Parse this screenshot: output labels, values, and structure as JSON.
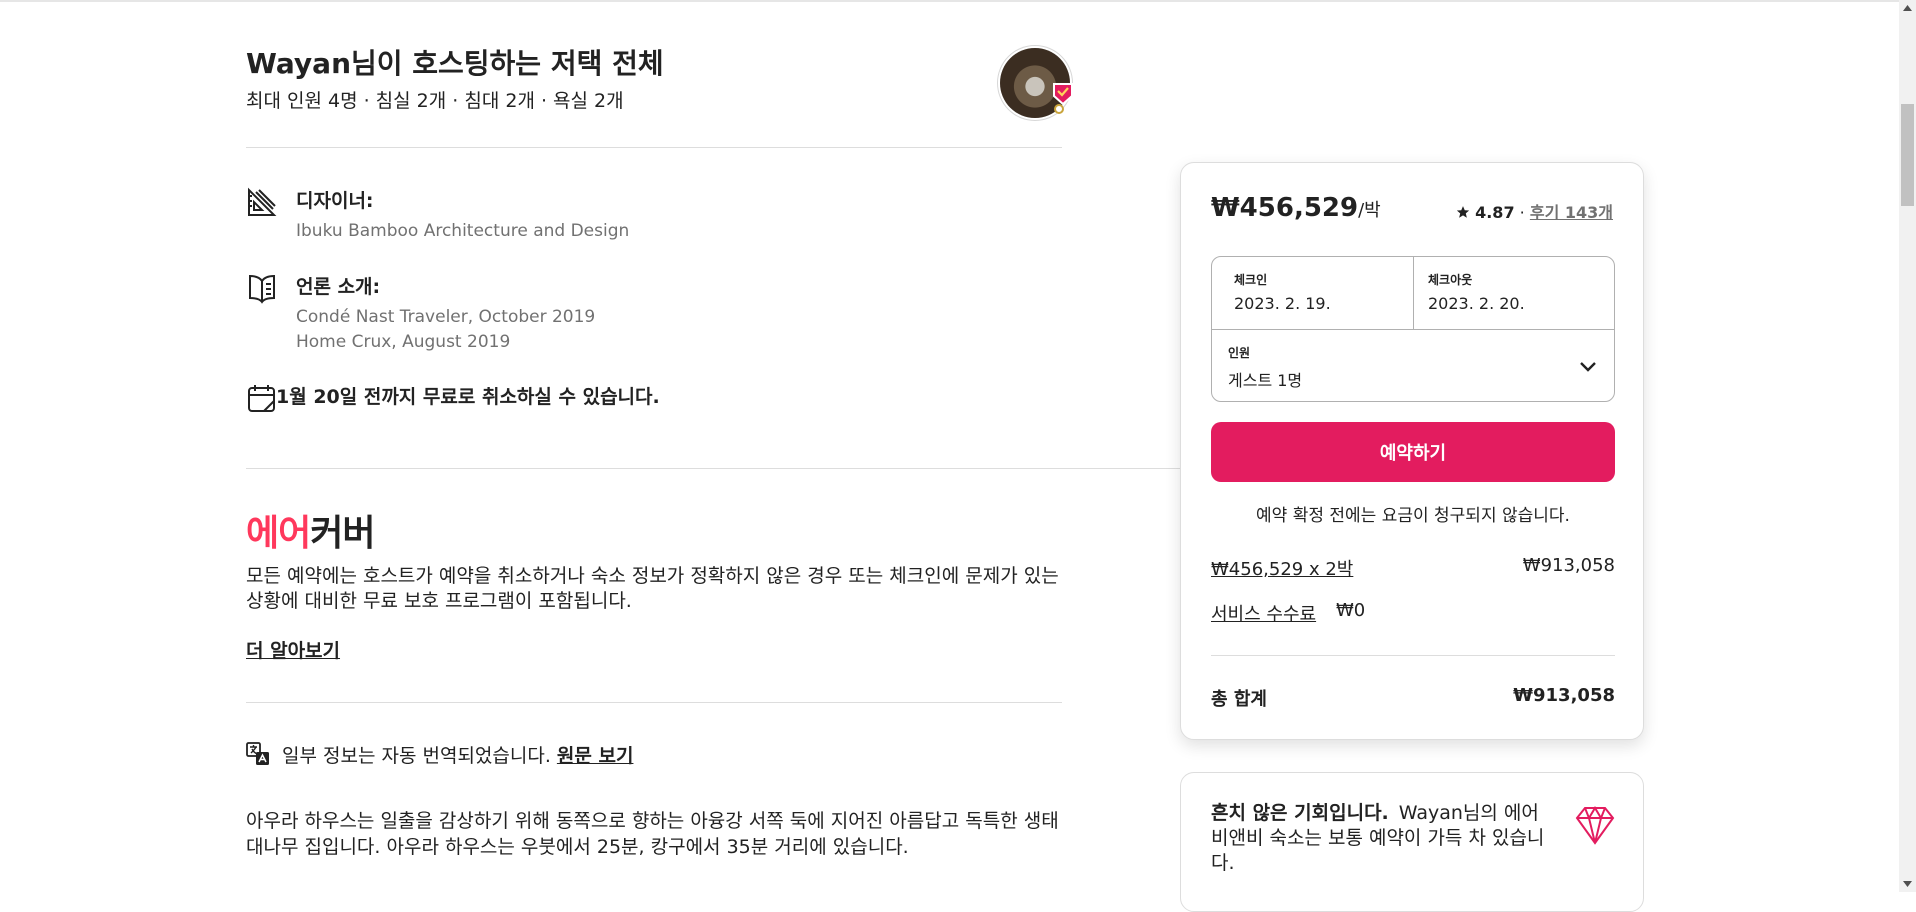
{
  "listing": {
    "title": "Wayan님이 호스팅하는 저택 전체",
    "subtitle": "최대 인원 4명 · 침실 2개 · 침대 2개 · 욕실 2개"
  },
  "features": {
    "designer": {
      "title": "디자이너:",
      "lines": [
        "Ibuku Bamboo Architecture and Design"
      ]
    },
    "press": {
      "title": "언론 소개:",
      "lines": [
        "Condé Nast Traveler, October 2019",
        "Home Crux, August 2019"
      ]
    },
    "cancellation": "1월 20일 전까지 무료로 취소하실 수 있습니다."
  },
  "aircover": {
    "logo_part1": "에어",
    "logo_part2": "커버",
    "description": "모든 예약에는 호스트가 예약을 취소하거나 숙소 정보가 정확하지 않은 경우 또는 체크인에 문제가 있는 상황에 대비한 무료 보호 프로그램이 포함됩니다.",
    "learn_more": "더 알아보기"
  },
  "translation": {
    "notice": "일부 정보는 자동 번역되었습니다.",
    "link": "원문 보기"
  },
  "description": "아우라 하우스는 일출을 감상하기 위해 동쪽으로 향하는 아융강 서쪽 둑에 지어진 아름답고 독특한 생태 대나무 집입니다. 아우라 하우스는 우붓에서 25분, 캉구에서 35분 거리에 있습니다.",
  "booking": {
    "price": "₩456,529",
    "price_unit": "/박",
    "rating": "4.87",
    "separator": "·",
    "reviews": "후기 143개",
    "checkin_label": "체크인",
    "checkin_value": "2023. 2. 19.",
    "checkout_label": "체크아웃",
    "checkout_value": "2023. 2. 20.",
    "guests_label": "인원",
    "guests_value": "게스트 1명",
    "reserve_button": "예약하기",
    "no_charge_notice": "예약 확정 전에는 요금이 청구되지 않습니다.",
    "nights_label": "₩456,529 x 2박",
    "nights_amount": "₩913,058",
    "service_fee_label": "서비스 수수료",
    "service_fee_amount": "₩0",
    "total_label": "총 합계",
    "total_amount": "₩913,058"
  },
  "rare_find": {
    "title": "흔치 않은 기회입니다.",
    "text": "Wayan님의 에어비앤비 숙소는 보통 예약이 가득 차 있습니다."
  },
  "colors": {
    "brand": "#ff385c",
    "reserve_button": "#e31c5f",
    "text": "#222222",
    "muted": "#717171",
    "border": "#dddddd"
  },
  "icons": {
    "designer": "drafting-tools-icon",
    "press": "open-book-icon",
    "cancellation": "calendar-icon",
    "translate": "translate-icon",
    "rating": "star-icon",
    "guests": "chevron-down-icon",
    "rare_find": "diamond-icon"
  }
}
